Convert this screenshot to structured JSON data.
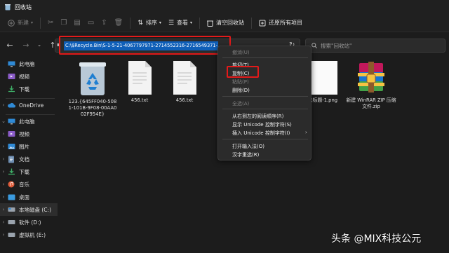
{
  "window": {
    "title": "回收站"
  },
  "toolbar": {
    "new_label": "新建",
    "sort_label": "排序",
    "view_label": "查看",
    "empty_bin_label": "清空回收站",
    "restore_all_label": "还原所有项目"
  },
  "address": {
    "path": "C:\\$Recycle.Bin\\S-1-5-21-4067797971-2714552316-2716549371-1001"
  },
  "search": {
    "placeholder": "搜索\"回收站\""
  },
  "sidebar": {
    "items": [
      {
        "label": "此电脑",
        "icon": "monitor-icon"
      },
      {
        "label": "视频",
        "icon": "video-folder-icon"
      },
      {
        "label": "下载",
        "icon": "download-folder-icon"
      },
      {
        "label": "OneDrive",
        "icon": "cloud-icon"
      },
      {
        "label": "此电脑",
        "icon": "monitor-icon"
      },
      {
        "label": "视频",
        "icon": "video-folder-icon"
      },
      {
        "label": "图片",
        "icon": "pictures-folder-icon"
      },
      {
        "label": "文档",
        "icon": "documents-folder-icon"
      },
      {
        "label": "下载",
        "icon": "download-folder-icon"
      },
      {
        "label": "音乐",
        "icon": "music-folder-icon"
      },
      {
        "label": "桌面",
        "icon": "desktop-folder-icon"
      },
      {
        "label": "本地磁盘 (C:)",
        "icon": "drive-icon"
      },
      {
        "label": "软件 (D:)",
        "icon": "drive-icon"
      },
      {
        "label": "虚拟机 (E:)",
        "icon": "drive-icon"
      }
    ]
  },
  "files": [
    {
      "name": "123.{645FF040-5081-101B-9F08-00AA002F954E}",
      "icon": "recycle-bin-icon"
    },
    {
      "name": "456.txt",
      "icon": "text-file-icon"
    },
    {
      "name": "456.txt",
      "icon": "text-file-icon"
    },
    {
      "name": "未标题-1.png",
      "icon": "image-file-icon"
    },
    {
      "name": "新建 WinRAR ZIP 压缩文件.zip",
      "icon": "winrar-archive-icon"
    }
  ],
  "context_menu": {
    "undo": "撤消(U)",
    "cut": "剪切(T)",
    "copy": "复制(C)",
    "paste": "粘贴(P)",
    "delete": "删除(D)",
    "select_all": "全选(A)",
    "rtl": "从右到左的阅读顺序(R)",
    "show_unicode": "显示 Unicode 控制字符(S)",
    "insert_unicode": "插入 Unicode 控制字符(I)",
    "open_ime": "打开输入法(O)",
    "reconversion": "汉字重选(R)"
  },
  "watermark": "头条 @MIX科技公元",
  "colors": {
    "background": "#1c1c1c",
    "accent": "#0f5fb8",
    "highlight": "#e31a1a"
  }
}
